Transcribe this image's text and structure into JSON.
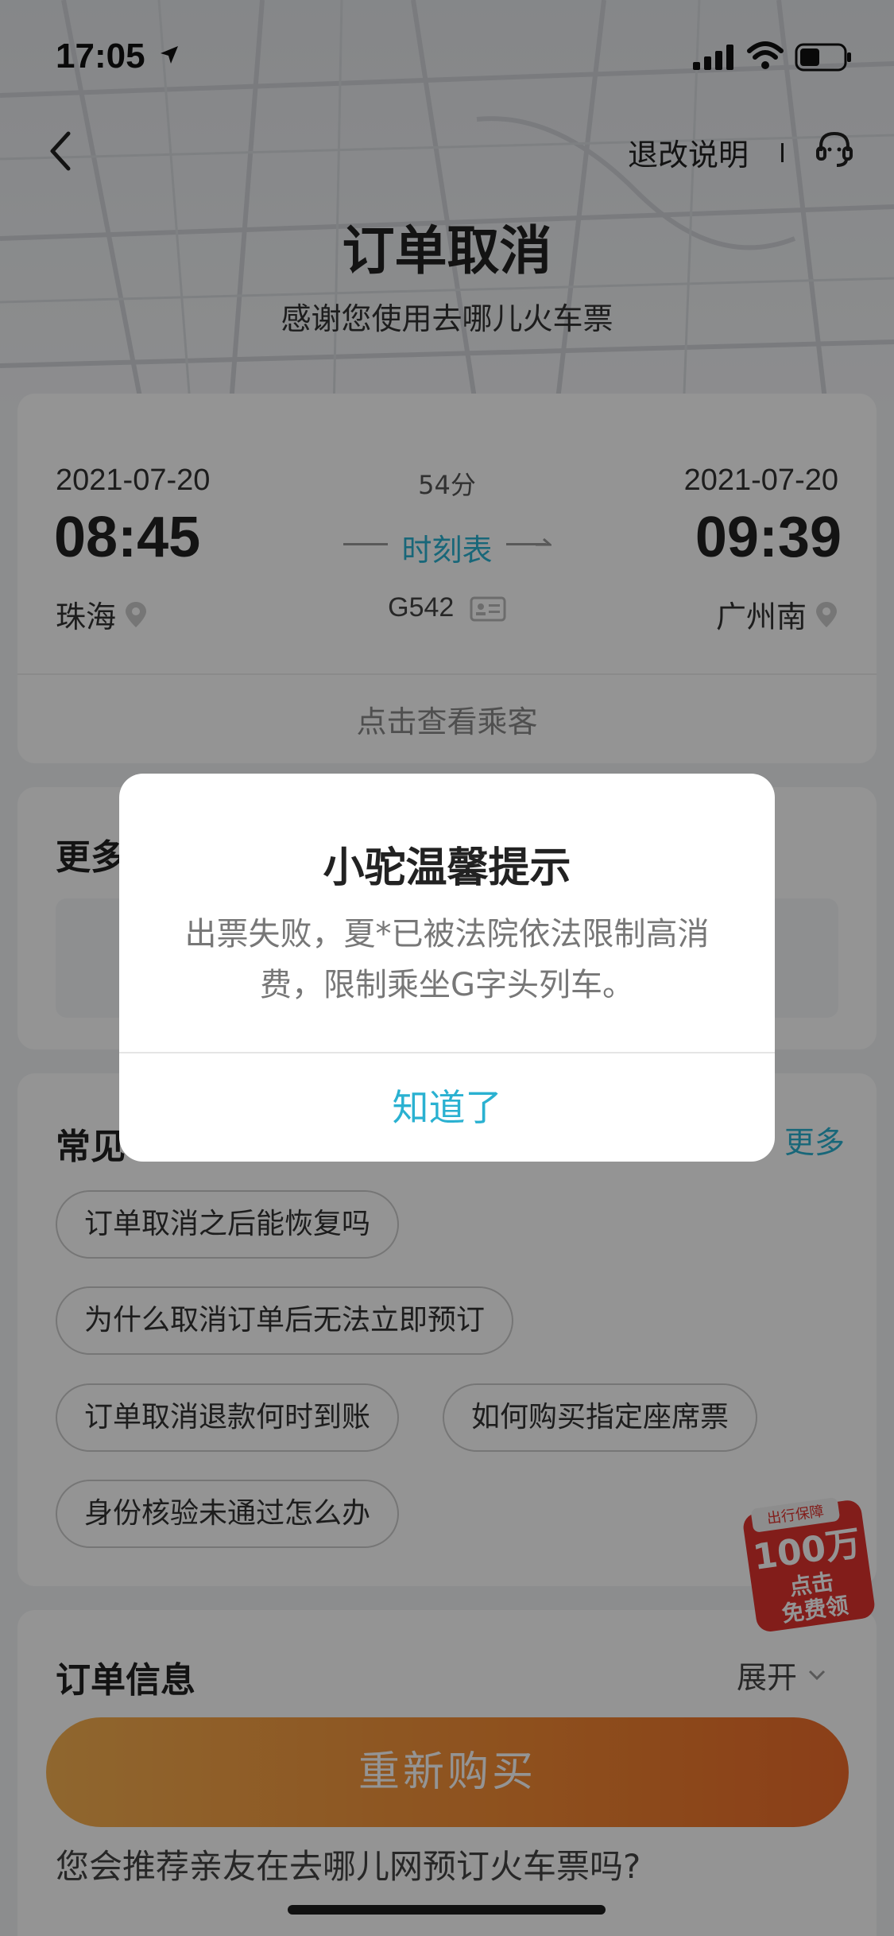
{
  "status_bar": {
    "time": "17:05"
  },
  "nav": {
    "rules_label": "退改说明"
  },
  "header": {
    "title": "订单取消",
    "subtitle": "感谢您使用去哪儿火车票"
  },
  "ticket": {
    "depart_date": "2021-07-20",
    "depart_time": "08:45",
    "depart_station": "珠海",
    "arrive_date": "2021-07-20",
    "arrive_time": "09:39",
    "arrive_station": "广州南",
    "duration": "54分",
    "schedule_link": "时刻表",
    "train_no": "G542",
    "passengers_link": "点击查看乘客"
  },
  "more_section": {
    "title": "更多"
  },
  "faq": {
    "title": "常见",
    "more_label": "更多",
    "items": [
      "订单取消之后能恢复吗",
      "为什么取消订单后无法立即预订",
      "订单取消退款何时到账",
      "如何购买指定座席票",
      "身份核验未通过怎么办"
    ]
  },
  "order_info": {
    "title": "订单信息",
    "expand_label": "展开"
  },
  "recommend": {
    "question": "您会推荐亲友在去哪儿网预订火车票吗?"
  },
  "rebuy": {
    "label": "重新购买"
  },
  "promo": {
    "tag": "出行保障",
    "amount": "100万",
    "line1": "点击",
    "line2": "免费领"
  },
  "dialog": {
    "title": "小驼温馨提示",
    "message": "出票失败，夏*已被法院依法限制高消费，限制乘坐G字头列车。",
    "confirm": "知道了"
  },
  "colors": {
    "accent": "#2ab1d1",
    "primary_button": "#f48a33",
    "promo_red": "#e0322e"
  }
}
